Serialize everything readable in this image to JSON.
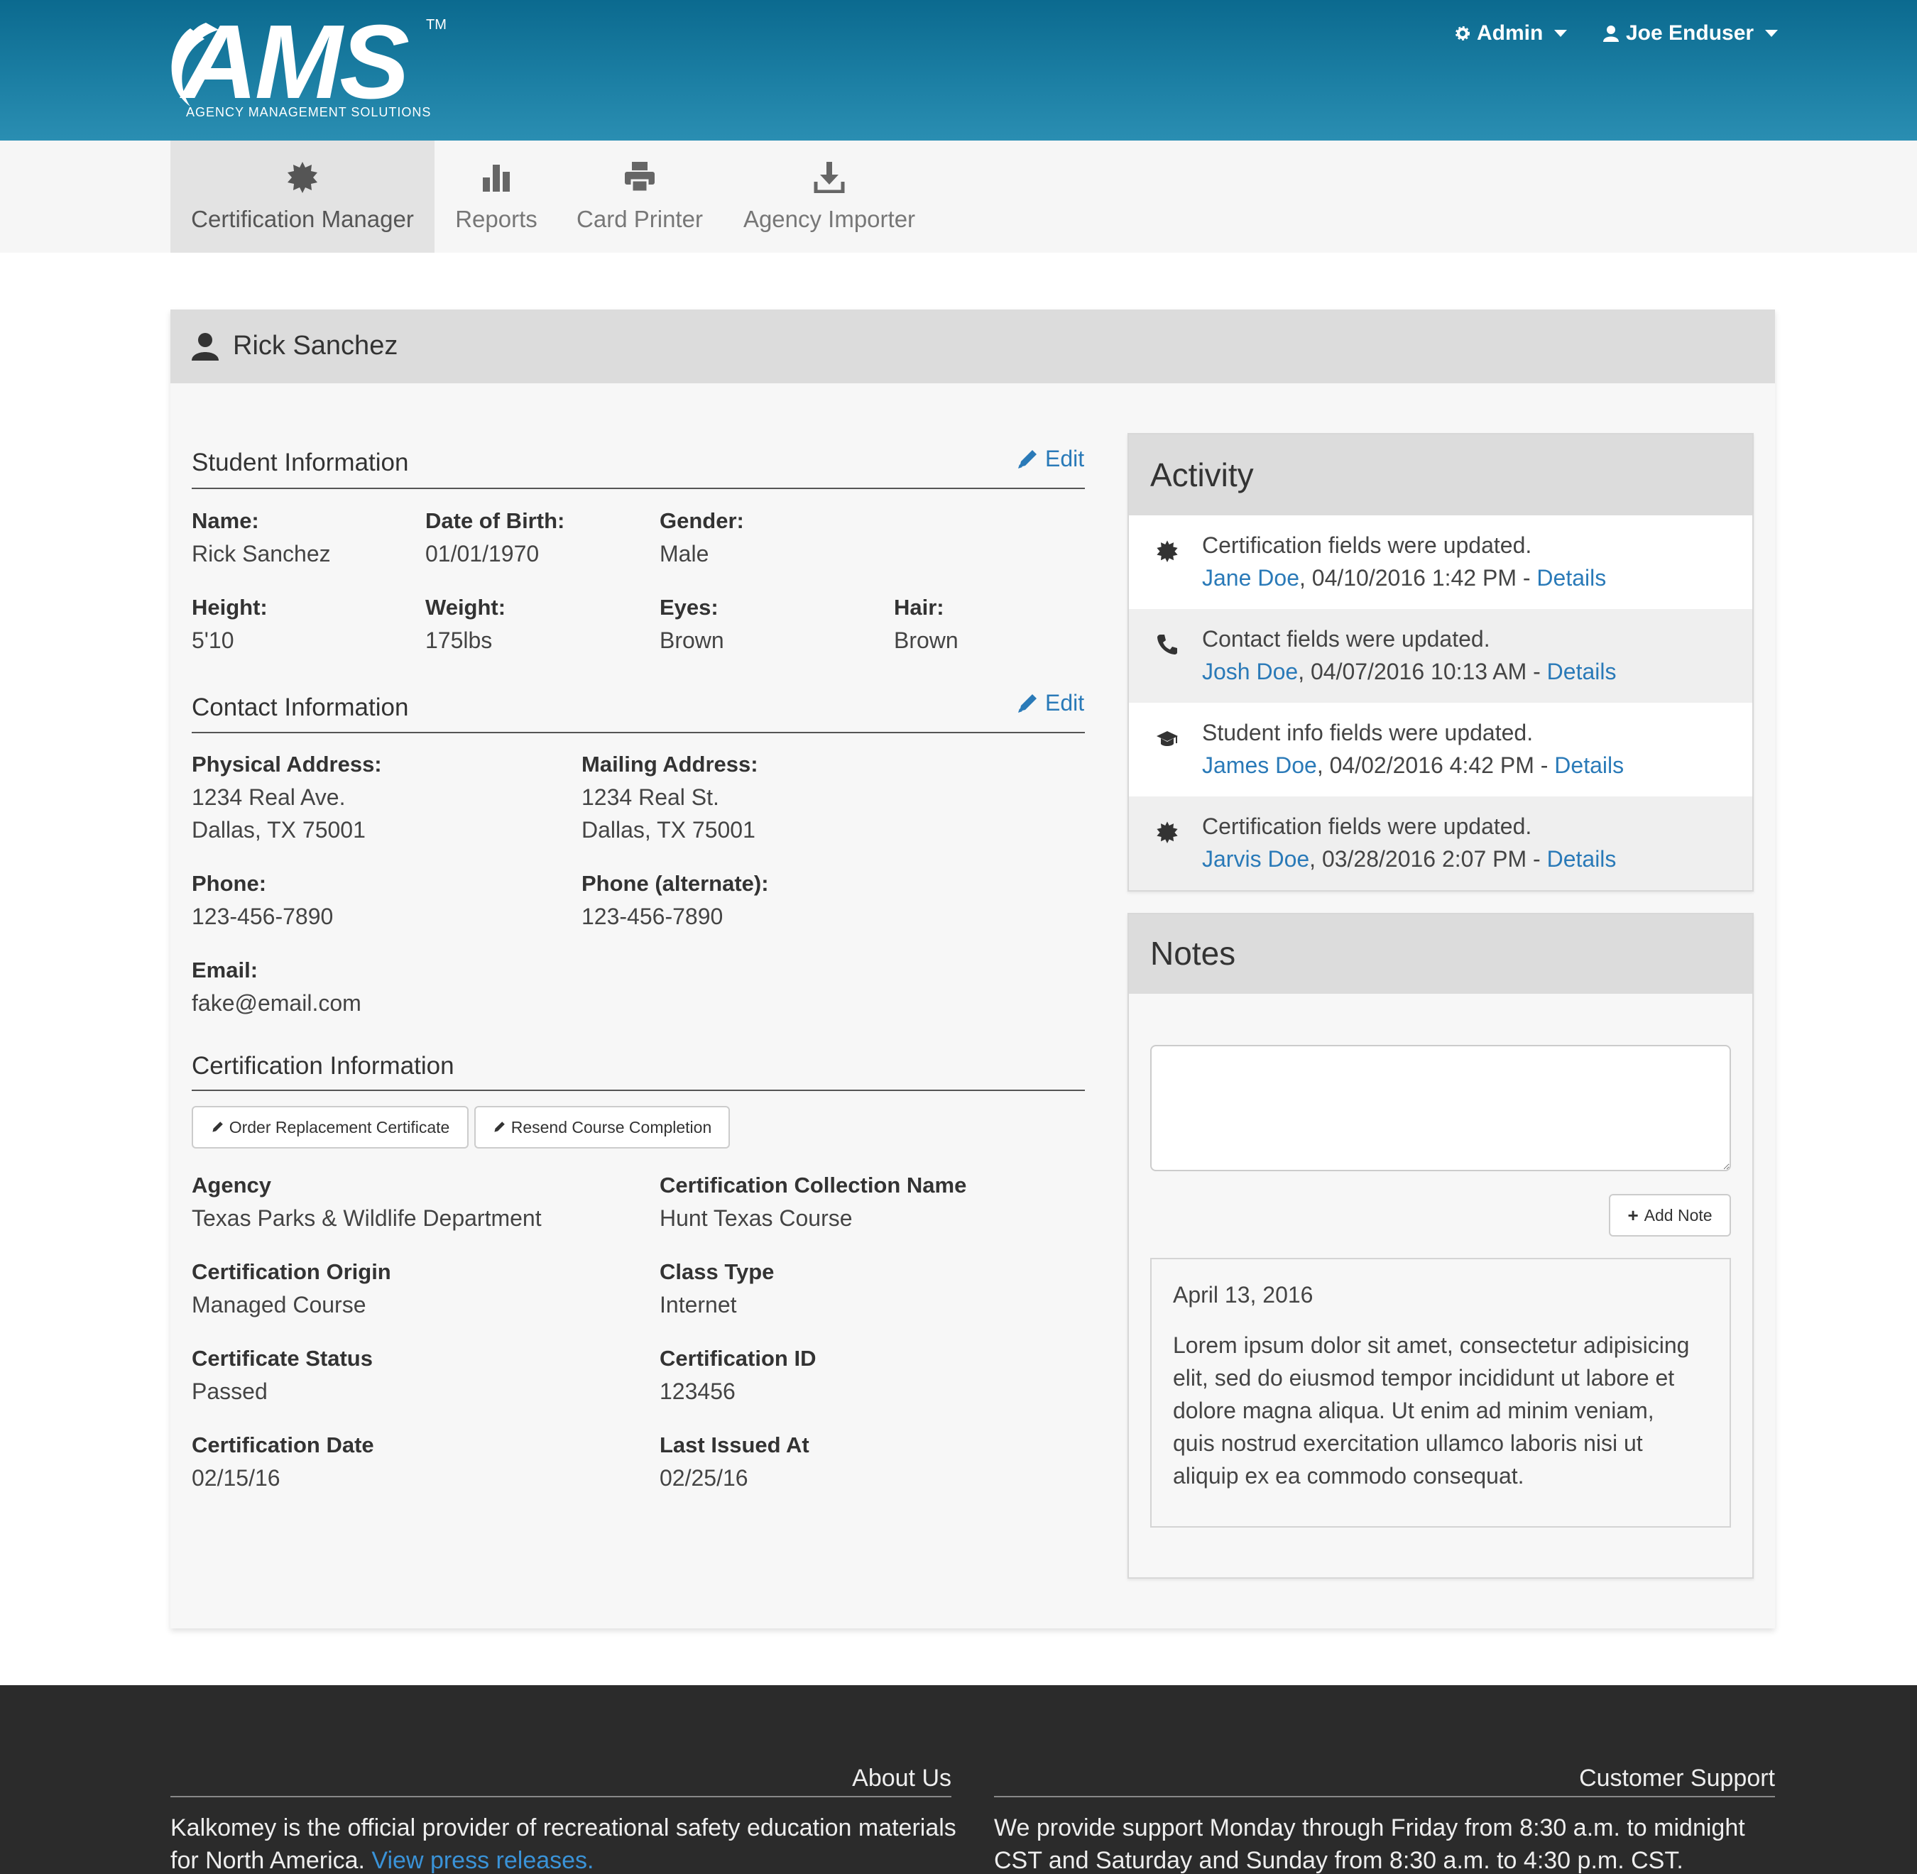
{
  "header": {
    "logo_text": "AMS",
    "logo_tm": "TM",
    "logo_subtitle": "AGENCY MANAGEMENT SOLUTIONS",
    "admin_menu": "Admin",
    "user_menu": "Joe Enduser"
  },
  "nav": {
    "items": [
      {
        "label": "Certification Manager",
        "icon": "badge-icon",
        "active": true
      },
      {
        "label": "Reports",
        "icon": "bar-chart-icon"
      },
      {
        "label": "Card Printer",
        "icon": "printer-icon"
      },
      {
        "label": "Agency Importer",
        "icon": "download-icon"
      }
    ]
  },
  "person": {
    "name": "Rick Sanchez"
  },
  "student_info": {
    "title": "Student Information",
    "edit_label": "Edit",
    "name_label": "Name:",
    "name": "Rick Sanchez",
    "dob_label": "Date of Birth:",
    "dob": "01/01/1970",
    "gender_label": "Gender:",
    "gender": "Male",
    "height_label": "Height:",
    "height": "5'10",
    "weight_label": "Weight:",
    "weight": "175lbs",
    "eyes_label": "Eyes:",
    "eyes": "Brown",
    "hair_label": "Hair:",
    "hair": "Brown"
  },
  "contact_info": {
    "title": "Contact Information",
    "edit_label": "Edit",
    "physical_label": "Physical Address:",
    "physical_line1": "1234 Real Ave.",
    "physical_line2": "Dallas, TX 75001",
    "mailing_label": "Mailing Address:",
    "mailing_line1": "1234 Real St.",
    "mailing_line2": "Dallas, TX 75001",
    "phone_label": "Phone:",
    "phone": "123-456-7890",
    "phone_alt_label": "Phone (alternate):",
    "phone_alt": "123-456-7890",
    "email_label": "Email:",
    "email": "fake@email.com"
  },
  "cert_info": {
    "title": "Certification Information",
    "order_button": "Order Replacement Certificate",
    "resend_button": "Resend Course Completion",
    "agency_label": "Agency",
    "agency": "Texas Parks & Wildlife Department",
    "collection_label": "Certification Collection Name",
    "collection": "Hunt Texas Course",
    "origin_label": "Certification Origin",
    "origin": "Managed Course",
    "class_label": "Class Type",
    "class_type": "Internet",
    "status_label": "Certificate Status",
    "status": "Passed",
    "id_label": "Certification ID",
    "id": "123456",
    "date_label": "Certification Date",
    "date": "02/15/16",
    "issued_label": "Last Issued At",
    "issued": "02/25/16"
  },
  "activity": {
    "title": "Activity",
    "items": [
      {
        "icon": "badge-icon",
        "text": "Certification fields were updated.",
        "user": "Jane Doe",
        "when": ", 04/10/2016 1:42 PM - ",
        "details": "Details"
      },
      {
        "icon": "phone-icon",
        "text": "Contact fields were updated.",
        "user": "Josh Doe",
        "when": ", 04/07/2016 10:13 AM - ",
        "details": "Details"
      },
      {
        "icon": "graduation-cap-icon",
        "text": "Student info fields were updated.",
        "user": "James Doe",
        "when": ", 04/02/2016 4:42 PM - ",
        "details": "Details"
      },
      {
        "icon": "badge-icon",
        "text": "Certification fields were updated.",
        "user": "Jarvis Doe",
        "when": ", 03/28/2016 2:07 PM - ",
        "details": "Details"
      }
    ]
  },
  "notes": {
    "title": "Notes",
    "textarea_value": "",
    "add_button": "Add Note",
    "note_date": "April 13, 2016",
    "note_line1": "Lorem ipsum dolor sit amet, consectetur adipisicing",
    "note_line2": "elit, sed do eiusmod tempor incididunt ut labore et",
    "note_line3": "dolore magna aliqua. Ut enim ad minim veniam,",
    "note_line4": "quis nostrud exercitation ullamco laboris nisi ut",
    "note_line5": "aliquip ex ea commodo consequat."
  },
  "footer": {
    "about_title": "About Us",
    "about_line1": "Kalkomey is the official provider of recreational safety education materials",
    "about_line2": "for North America. ",
    "press_link": "View press releases.",
    "support_title": "Customer Support",
    "support_line1": "We provide support Monday through Friday from 8:30 a.m. to midnight",
    "support_line2": "CST and Saturday and Sunday from 8:30 a.m. to 4:30 p.m. CST."
  },
  "colors": {
    "header": "#1b7ea3",
    "link": "#2a7ab8",
    "footer": "#2b2b2b"
  }
}
